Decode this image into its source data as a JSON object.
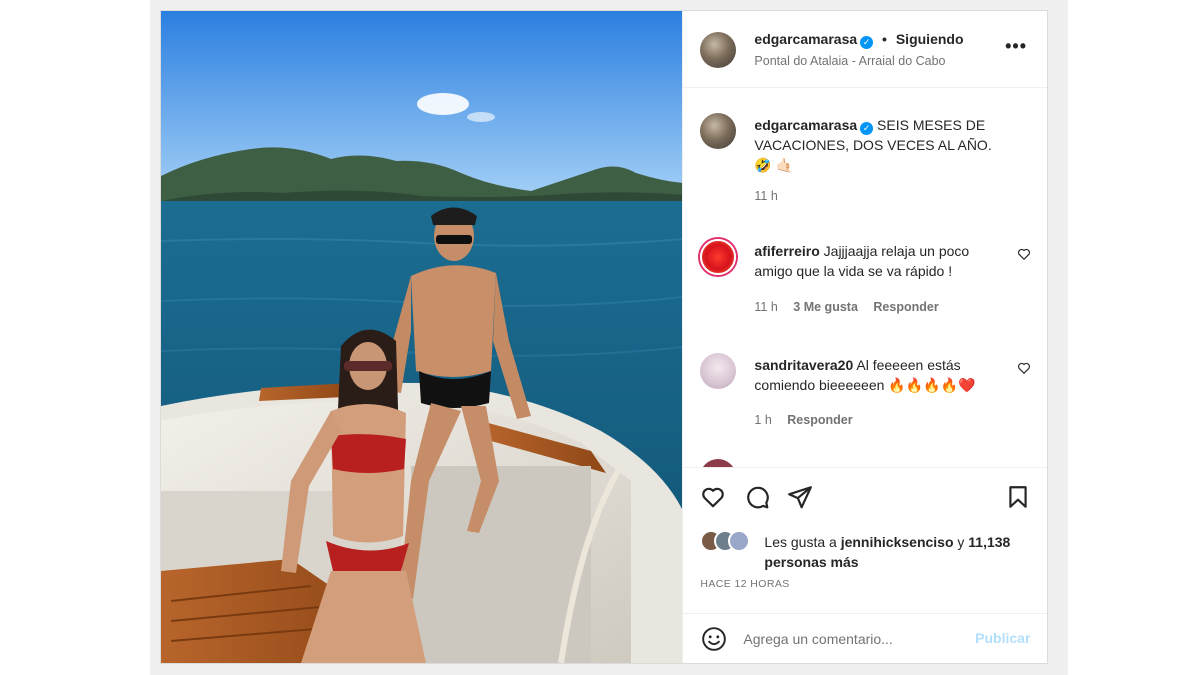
{
  "post": {
    "author": "edgarcamarasa",
    "separator": "•",
    "follow_label": "Siguiendo",
    "location": "Pontal do Atalaia - Arraial do Cabo",
    "more_label": "•••",
    "verified_glyph": "✓",
    "photo_alt": "Pareja sentada en la proa de una lancha en el mar"
  },
  "caption": {
    "author": "edgarcamarasa",
    "text": "SEIS MESES DE VACACIONES, DOS VECES AL AÑO. 🤣 🤙🏻",
    "time": "11 h"
  },
  "comments": [
    {
      "author": "afiferreiro",
      "text": "Jajjjaajja relaja un poco amigo que la vida se va rápido !",
      "time": "11 h",
      "likes": "3 Me gusta",
      "reply": "Responder"
    },
    {
      "author": "sandritavera20",
      "text": "Al feeeeen estás comiendo bieeeeeen 🔥🔥🔥🔥❤️",
      "time": "1 h",
      "reply": "Responder"
    }
  ],
  "likes": {
    "prefix": "Les gusta a",
    "user": "jennihicksenciso",
    "joiner": "y",
    "count": "11,138 personas más"
  },
  "time_ago": "HACE 12 HORAS",
  "comment_box": {
    "placeholder": "Agrega un comentario...",
    "publish": "Publicar"
  },
  "icons": {
    "like": "heart-icon",
    "comment": "comment-icon",
    "share": "share-icon",
    "save": "bookmark-icon",
    "emoji": "emoji-icon",
    "more": "more-icon",
    "verified": "verified-icon"
  },
  "colors": {
    "verified": "#0095f6",
    "publish_disabled": "#b2dffc",
    "muted_text": "#737373"
  }
}
